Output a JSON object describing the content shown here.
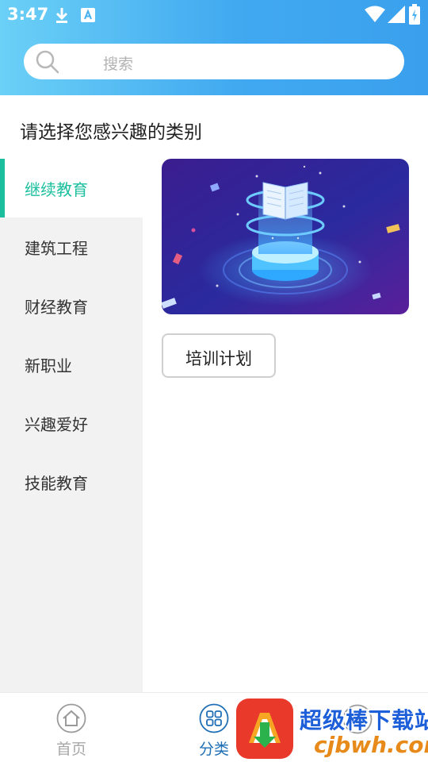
{
  "status_bar": {
    "time": "3:47",
    "icons": [
      "download-icon",
      "a-box-icon",
      "wifi-icon",
      "signal-icon",
      "battery-charging-icon"
    ]
  },
  "search": {
    "placeholder": "搜索",
    "icon": "search-icon"
  },
  "page_title": "请选择您感兴趣的类别",
  "sidebar": {
    "items": [
      {
        "label": "继续教育",
        "active": true
      },
      {
        "label": "建筑工程",
        "active": false
      },
      {
        "label": "财经教育",
        "active": false
      },
      {
        "label": "新职业",
        "active": false
      },
      {
        "label": "兴趣爱好",
        "active": false
      },
      {
        "label": "技能教育",
        "active": false
      }
    ],
    "active_color": "#1bbf9e"
  },
  "content": {
    "banner": "open-book-illustration",
    "tags": [
      {
        "label": "培训计划"
      }
    ]
  },
  "bottom_nav": {
    "items": [
      {
        "label": "首页",
        "icon": "home-icon",
        "active": false
      },
      {
        "label": "分类",
        "icon": "grid-icon",
        "active": true
      }
    ]
  },
  "watermark": {
    "title": "超级棒下载站",
    "url": "cjbwh.com",
    "icon": "download-arrow-logo"
  }
}
